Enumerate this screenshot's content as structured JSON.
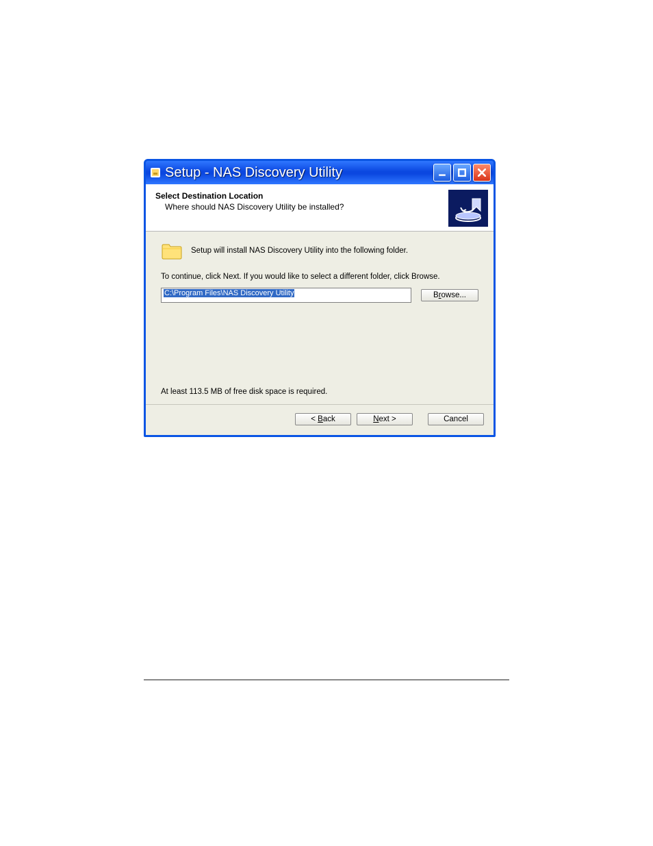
{
  "window": {
    "title": "Setup - NAS Discovery Utility"
  },
  "header": {
    "title": "Select Destination Location",
    "subtitle": "Where should NAS Discovery Utility be installed?"
  },
  "body": {
    "intro": "Setup will install NAS Discovery Utility into the following folder.",
    "instruction": "To continue, click Next. If you would like to select a different folder, click Browse.",
    "path": "C:\\Program Files\\NAS Discovery Utility",
    "browse_label": "Browse...",
    "disk_req": "At least 113.5 MB of free disk space is required."
  },
  "footer": {
    "back_label": "< Back",
    "next_label": "Next >",
    "cancel_label": "Cancel"
  },
  "icons": {
    "title": "installer-icon",
    "minimize": "minimize-icon",
    "maximize": "maximize-icon",
    "close": "close-icon",
    "header": "install-drive-icon",
    "folder": "folder-icon"
  }
}
